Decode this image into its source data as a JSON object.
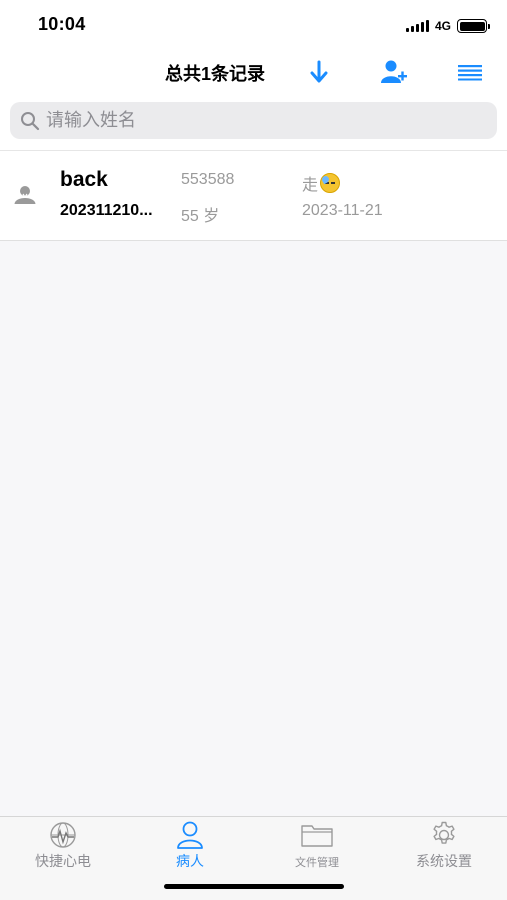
{
  "status_bar": {
    "time": "10:04",
    "network": "4G"
  },
  "header": {
    "title": "总共1条记录",
    "icons": [
      "download-icon",
      "add-user-icon",
      "menu-icon"
    ],
    "accent_color": "#1a8cff"
  },
  "search": {
    "placeholder": "请输入姓名",
    "value": ""
  },
  "patients": [
    {
      "name": "back",
      "record_id": "202311210...",
      "code": "553588",
      "age": "55 岁",
      "status": "走",
      "date": "2023-11-21"
    }
  ],
  "tab_bar": {
    "tabs": [
      {
        "label": "快捷心电",
        "icon": "ecg-globe-icon",
        "active": false
      },
      {
        "label": "病人",
        "icon": "person-icon",
        "active": true
      },
      {
        "label": "文件管理",
        "icon": "folder-icon",
        "active": false
      },
      {
        "label": "系统设置",
        "icon": "gear-icon",
        "active": false
      }
    ]
  }
}
